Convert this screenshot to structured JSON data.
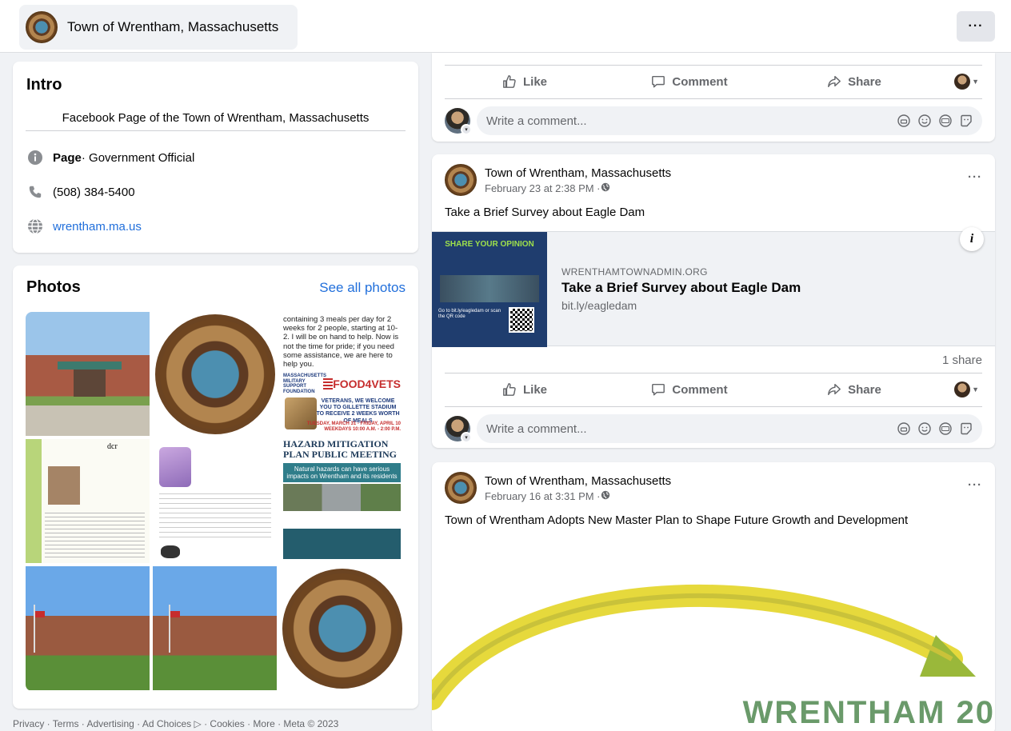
{
  "header": {
    "page_name": "Town of Wrentham, Massachusetts",
    "more_label": "···"
  },
  "intro": {
    "title": "Intro",
    "description": "Facebook Page of the Town of Wrentham, Massachusetts",
    "category_bold": "Page",
    "category_rest": " · Government Official",
    "phone": "(508) 384-5400",
    "website": "wrentham.ma.us"
  },
  "photos": {
    "title": "Photos",
    "see_all": "See all photos",
    "food_text": "containing 3 meals per day for 2 weeks for 2 people, starting at 10-2. I will be on hand to help. Now is not the time for pride; if you need some assistance, we are here to help you.",
    "food_org": "MASSACHUSETTS MILITARY SUPPORT FOUNDATION",
    "food_brand": "FOOD4VETS",
    "food_vets": "VETERANS, WE WELCOME YOU TO GILLETTE STADIUM TO RECEIVE 2 WEEKS WORTH OF MEALS",
    "food_date": "TUESDAY, MARCH 31 - FRIDAY, APRIL 10 WEEKDAYS 10:00 A.M. - 2:00 P.M.",
    "dcr_logo": "dcr",
    "hazard_title": "HAZARD MITIGATION PLAN PUBLIC MEETING",
    "hazard_band": "Natural hazards can have serious impacts on Wrentham and its residents"
  },
  "footer": {
    "text": "Privacy · Terms · Advertising · Ad Choices ▷ · Cookies · More · Meta © 2023"
  },
  "actions": {
    "like": "Like",
    "comment": "Comment",
    "share": "Share",
    "comment_placeholder": "Write a comment..."
  },
  "post2": {
    "author": "Town of Wrentham, Massachusetts",
    "time": "February 23 at 2:38 PM · ",
    "text": "Take a Brief Survey about Eagle Dam",
    "link_domain": "WRENTHAMTOWNADMIN.ORG",
    "link_title": "Take a Brief Survey about Eagle Dam",
    "link_url": "bit.ly/eagledam",
    "thumb_heading": "SHARE YOUR OPINION",
    "thumb_go": "Go to bit.ly/eagledam or scan the QR code",
    "share_count": "1 share"
  },
  "post3": {
    "author": "Town of Wrentham, Massachusetts",
    "time": "February 16 at 3:31 PM · ",
    "text": "Town of Wrentham Adopts New Master Plan to Shape Future Growth and Development",
    "image_wordmark": "WRENTHAM 20"
  },
  "colors": {
    "link_blue": "#216fdb",
    "secondary_text": "#65676b",
    "page_bg": "#f0f2f5"
  }
}
